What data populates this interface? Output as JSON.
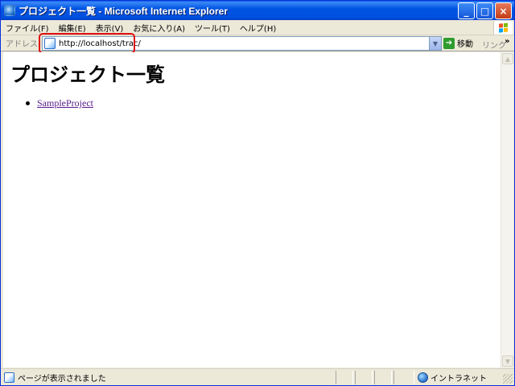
{
  "window": {
    "title": "プロジェクト一覧 - Microsoft Internet Explorer",
    "minimize_glyph": "_",
    "maximize_glyph": "□",
    "close_glyph": "×"
  },
  "menu": [
    "ファイル(F)",
    "編集(E)",
    "表示(V)",
    "お気に入り(A)",
    "ツール(T)",
    "ヘルプ(H)"
  ],
  "address": {
    "label": "アドレス(D)",
    "url": "http://localhost/trac/",
    "go_label": "移動",
    "links_label": "リンク",
    "links_chevron": "»"
  },
  "page": {
    "heading": "プロジェクト一覧",
    "projects": [
      "SampleProject"
    ]
  },
  "status": {
    "text": "ページが表示されました",
    "zone": "イントラネット"
  },
  "colors": {
    "titlebar": "#0054E3",
    "highlight": "#E01010",
    "visited_link": "#551A8B"
  },
  "icons": [
    "ie-app-icon",
    "windows-logo-icon",
    "page-icon",
    "go-arrow-icon",
    "globe-icon"
  ]
}
